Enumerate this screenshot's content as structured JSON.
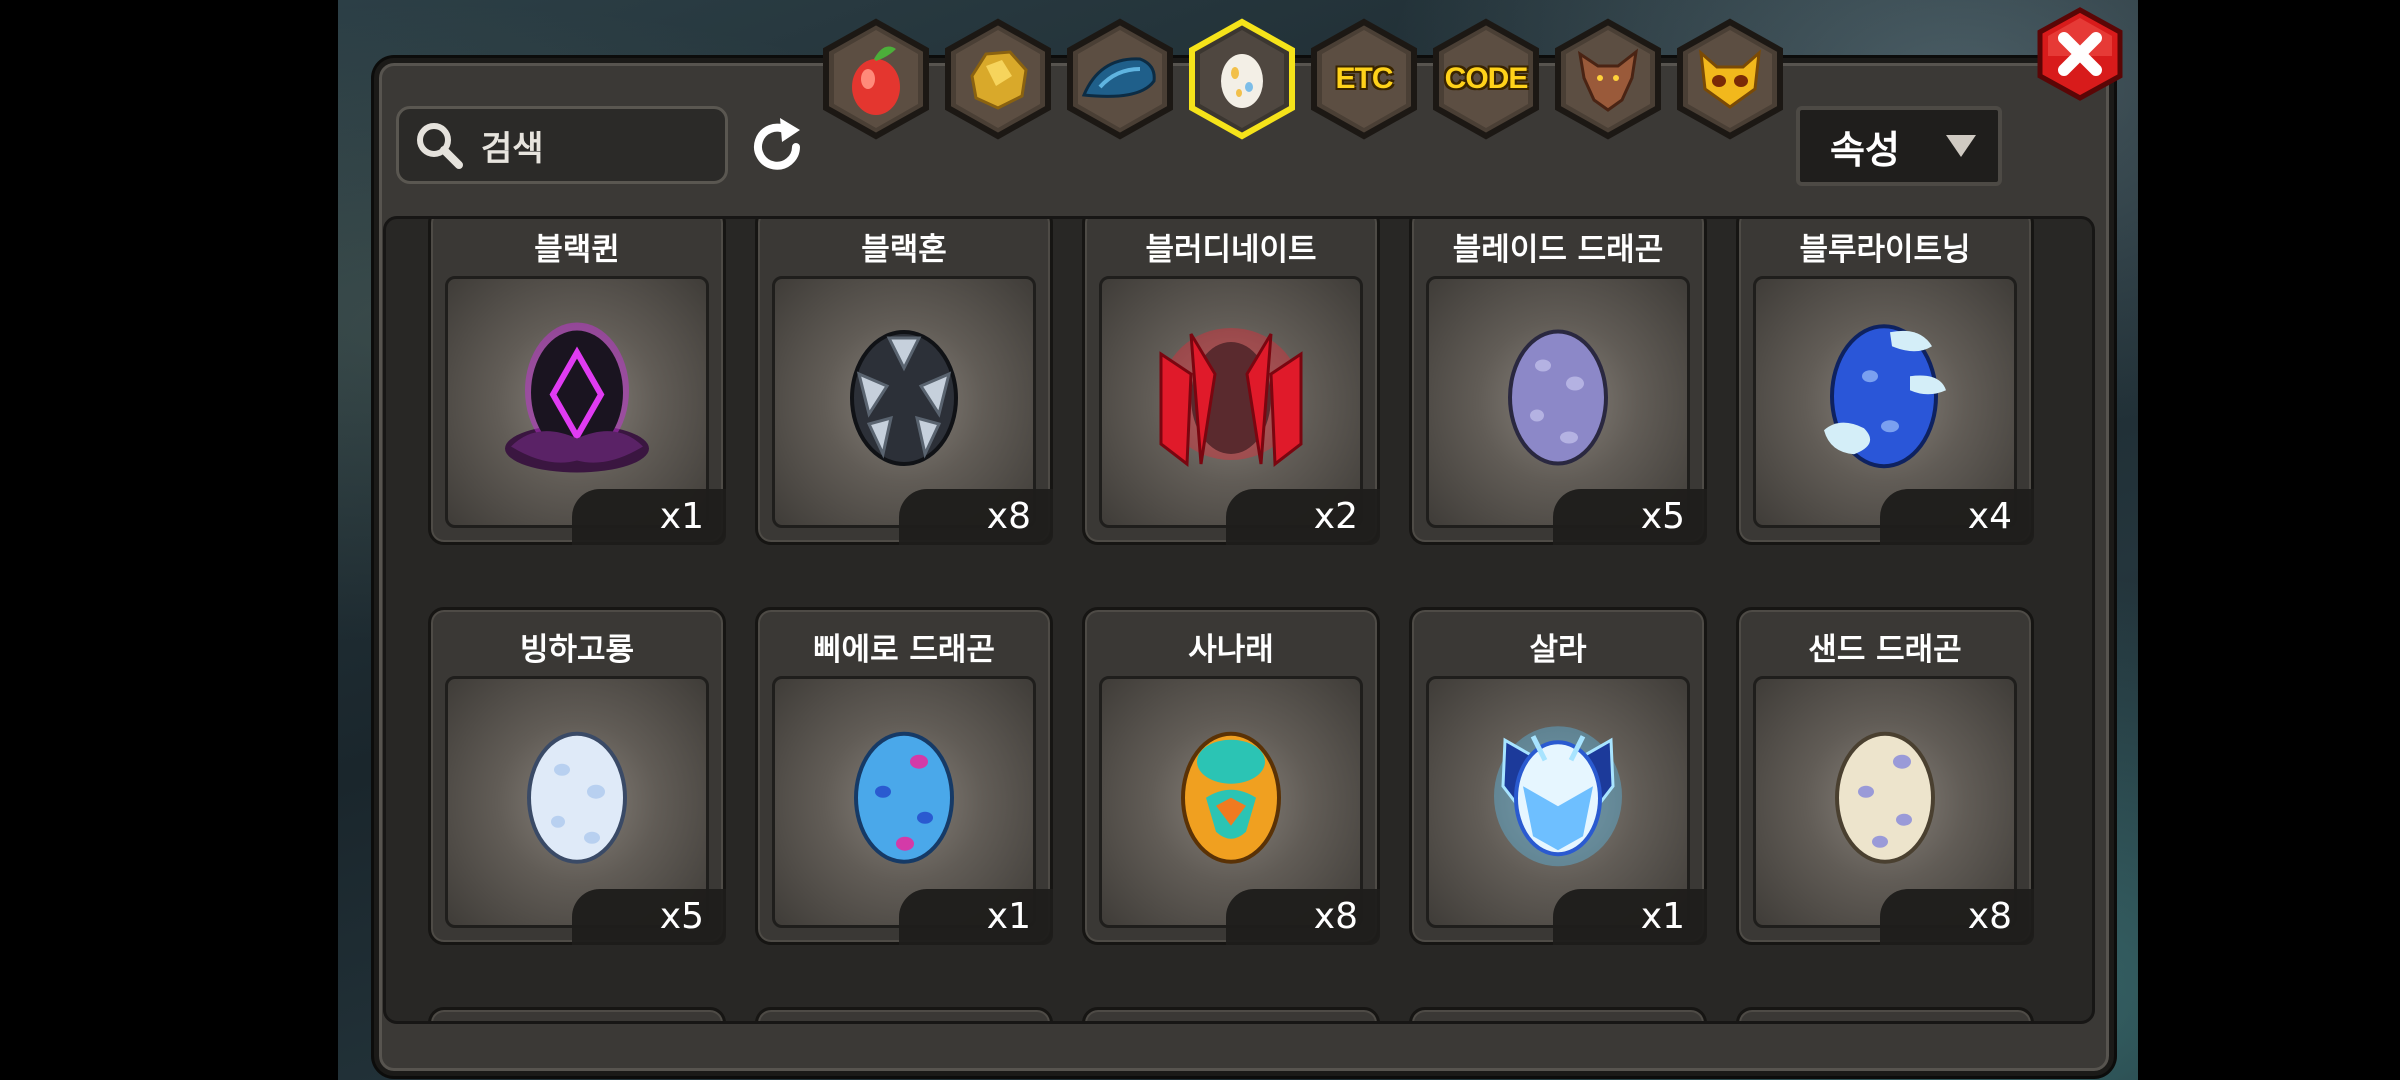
{
  "search": {
    "placeholder": "검색"
  },
  "sort": {
    "label": "속성"
  },
  "tabs": [
    {
      "name": "fruit",
      "label": ""
    },
    {
      "name": "gold-ore",
      "label": ""
    },
    {
      "name": "dragon-scale",
      "label": ""
    },
    {
      "name": "egg",
      "label": ""
    },
    {
      "name": "etc",
      "label": "ETC"
    },
    {
      "name": "code",
      "label": "CODE"
    },
    {
      "name": "wolf",
      "label": ""
    },
    {
      "name": "mask",
      "label": ""
    }
  ],
  "selected_tab": "egg",
  "colors": {
    "accent": "#ffd21a",
    "close_red": "#d81b1b",
    "selected_tab_border": "#f5e31a"
  },
  "items": [
    {
      "name": "블랙퀸",
      "qty": "x1",
      "icon": "black-queen-egg-icon"
    },
    {
      "name": "블랙혼",
      "qty": "x8",
      "icon": "black-horn-egg-icon"
    },
    {
      "name": "블러디네이트",
      "qty": "x2",
      "icon": "bloody-nate-egg-icon"
    },
    {
      "name": "블레이드 드래곤",
      "qty": "x5",
      "icon": "blade-dragon-egg-icon"
    },
    {
      "name": "블루라이트닝",
      "qty": "x4",
      "icon": "blue-lightning-egg-icon"
    },
    {
      "name": "빙하고룡",
      "qty": "x5",
      "icon": "glacier-dragon-egg-icon"
    },
    {
      "name": "삐에로 드래곤",
      "qty": "x1",
      "icon": "pierrot-dragon-egg-icon"
    },
    {
      "name": "사나래",
      "qty": "x8",
      "icon": "sanarae-egg-icon"
    },
    {
      "name": "살라",
      "qty": "x1",
      "icon": "sala-egg-icon"
    },
    {
      "name": "샌드 드래곤",
      "qty": "x8",
      "icon": "sand-dragon-egg-icon"
    }
  ]
}
